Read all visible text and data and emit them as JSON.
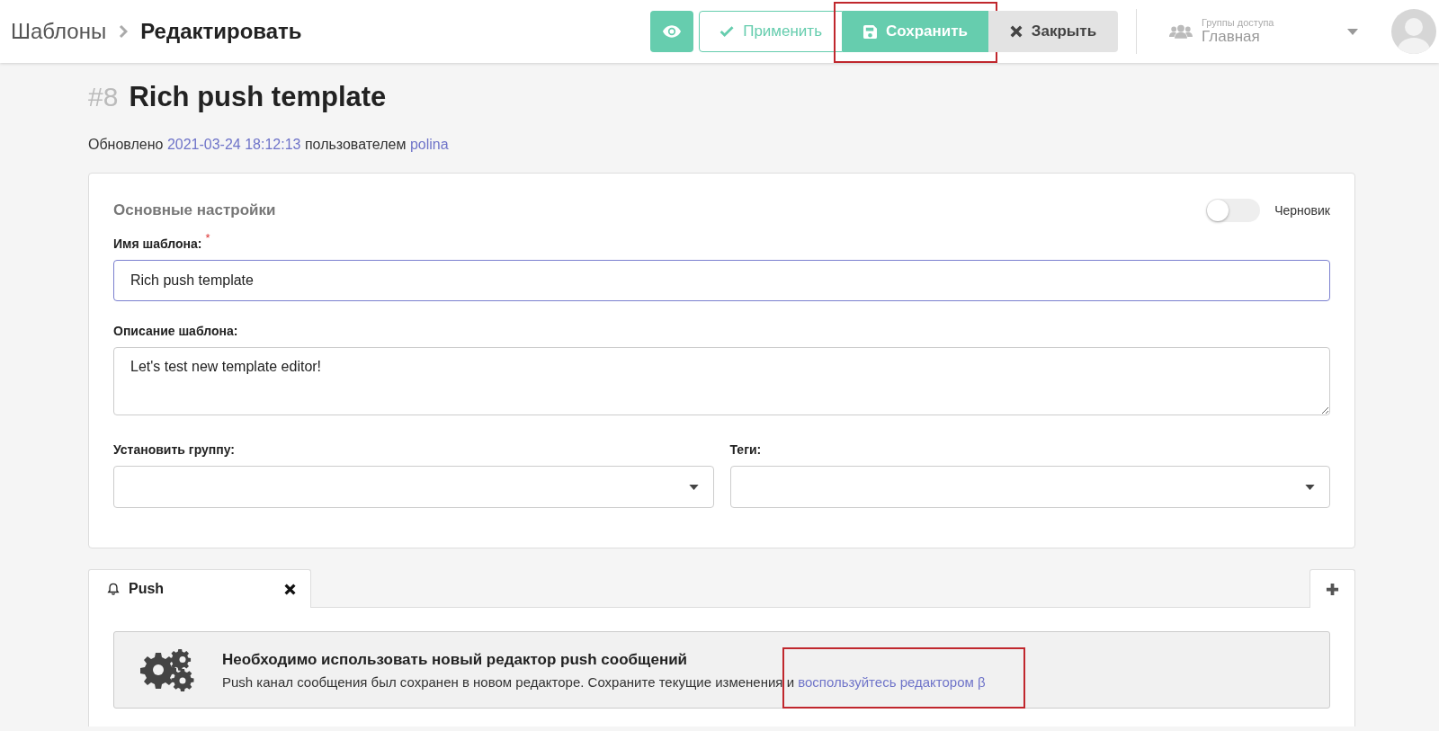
{
  "breadcrumb": [
    {
      "label": "Шаблоны",
      "current": false
    },
    {
      "label": "Редактировать",
      "current": true
    }
  ],
  "toolbar": {
    "buttons": [
      {
        "kind": "preview",
        "highlighted": false
      },
      {
        "kind": "apply",
        "label": "Применить",
        "highlighted": false
      },
      {
        "kind": "save",
        "label": "Сохранить",
        "highlighted": true
      },
      {
        "kind": "close",
        "label": "Закрыть",
        "highlighted": false
      }
    ],
    "access_group": {
      "label": "Группы доступа",
      "value": "Главная"
    }
  },
  "template": {
    "number": "#8",
    "title": "Rich push template"
  },
  "updated": {
    "prefix": "Обновлено",
    "date": "2021-03-24 18:12:13",
    "middle": "пользователем",
    "user": "polina"
  },
  "settings": {
    "title": "Основные настройки",
    "draft_toggle": {
      "label": "Черновик",
      "on": false
    },
    "name_field": {
      "label": "Имя шаблона:",
      "required_mark": "*",
      "value": "Rich push template"
    },
    "description_field": {
      "label": "Описание шаблона:",
      "value": "Let's test new template editor!"
    },
    "group_select": {
      "label": "Установить группу:"
    },
    "tags_select": {
      "label": "Теги:"
    }
  },
  "channel_tabs": [
    {
      "kind": "push",
      "label": "Push",
      "selected": true
    }
  ],
  "notice": {
    "title": "Необходимо использовать новый редактор push сообщений",
    "text": "Push канал сообщения был сохранен в новом редакторе. Сохраните текущие изменения и",
    "link": {
      "label": "воспользуйтесь редактором β",
      "highlighted": true
    }
  }
}
